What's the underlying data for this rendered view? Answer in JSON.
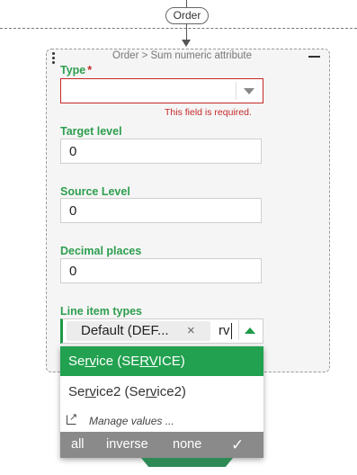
{
  "flow": {
    "connector_label": "Order"
  },
  "node": {
    "title": "Order > Sum numeric attribute",
    "fields": {
      "type": {
        "label": "Type",
        "required_mark": "*",
        "value": "",
        "error": "This field is required."
      },
      "target_level": {
        "label": "Target level",
        "value": "0"
      },
      "source_level": {
        "label": "Source Level",
        "value": "0"
      },
      "decimal_places": {
        "label": "Decimal places",
        "value": "0"
      },
      "line_item_types": {
        "label": "Line item types",
        "chip_label": "Default (DEF...",
        "chip_remove": "×",
        "search_text": "rv"
      }
    }
  },
  "dropdown": {
    "options": [
      {
        "pre": "Se",
        "match": "rv",
        "mid": "ice (SE",
        "match2": "RV",
        "post": "ICE)",
        "selected": true
      },
      {
        "pre": "Se",
        "match": "rv",
        "mid": "ice2 (Se",
        "match2": "rv",
        "post": "ice2)",
        "selected": false
      }
    ],
    "manage_label": "Manage values ...",
    "footer": {
      "all": "all",
      "inverse": "inverse",
      "none": "none",
      "confirm": "✓"
    }
  },
  "colors": {
    "accent_green": "#22a150",
    "error_red": "#c62828",
    "footer_gray": "#8a8a8a"
  }
}
